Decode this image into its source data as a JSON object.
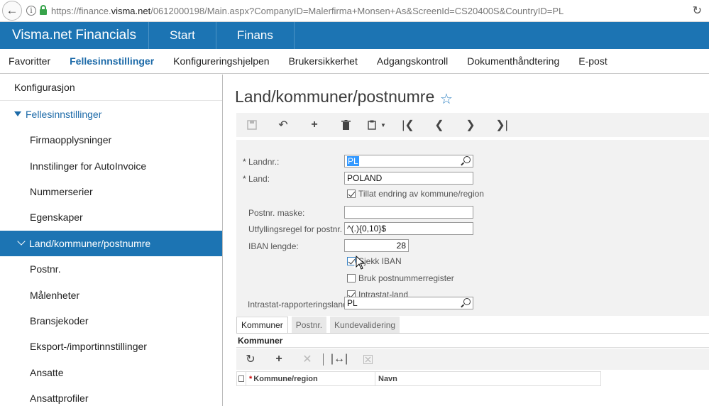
{
  "browser": {
    "url_prefix": "https://finance.",
    "url_domain": "visma.net",
    "url_rest": "/0612000198/Main.aspx?CompanyID=Malerfirma+Monsen+As&ScreenId=CS20400S&CountryID=PL"
  },
  "app": {
    "brand": "Visma.net Financials",
    "modules": [
      "Start",
      "Finans"
    ]
  },
  "submenu": [
    "Favoritter",
    "Fellesinnstillinger",
    "Konfigureringshjelpen",
    "Brukersikkerhet",
    "Adgangskontroll",
    "Dokumenthåndtering",
    "E-post"
  ],
  "sidebar": {
    "header": "Konfigurasjon",
    "group": "Fellesinnstillinger",
    "items": [
      "Firmaopplysninger",
      "Innstilinger for AutoInvoice",
      "Nummerserier",
      "Egenskaper",
      "Land/kommuner/postnumre",
      "Postnr.",
      "Målenheter",
      "Bransjekoder",
      "Eksport-/importinnstillinger",
      "Ansatte",
      "Ansattprofiler"
    ]
  },
  "page": {
    "title": "Land/kommuner/postnumre"
  },
  "form": {
    "landnr_label": "Landnr.:",
    "landnr_value": "PL",
    "land_label": "Land:",
    "land_value": "POLAND",
    "tillat_label": "Tillat endring av kommune/region",
    "tillat_checked": true,
    "maske_label": "Postnr. maske:",
    "maske_value": "",
    "utfylling_label": "Utfyllingsregel for postnr. ...",
    "utfylling_value": "^(.){0,10}$",
    "iban_label": "IBAN lengde:",
    "iban_value": "28",
    "sjekk_label": "Sjekk IBAN",
    "sjekk_checked": true,
    "bruk_label": "Bruk postnummerregister",
    "bruk_checked": false,
    "intrastat_label": "Intrastat-land",
    "intrastat_checked": true,
    "rapport_label": "Intrastat-rapporteringsland:",
    "rapport_value": "PL"
  },
  "tabs": [
    "Kommuner",
    "Postnr.",
    "Kundevalidering"
  ],
  "section": {
    "title": "Kommuner",
    "col1": "Kommune/region",
    "col2": "Navn"
  }
}
